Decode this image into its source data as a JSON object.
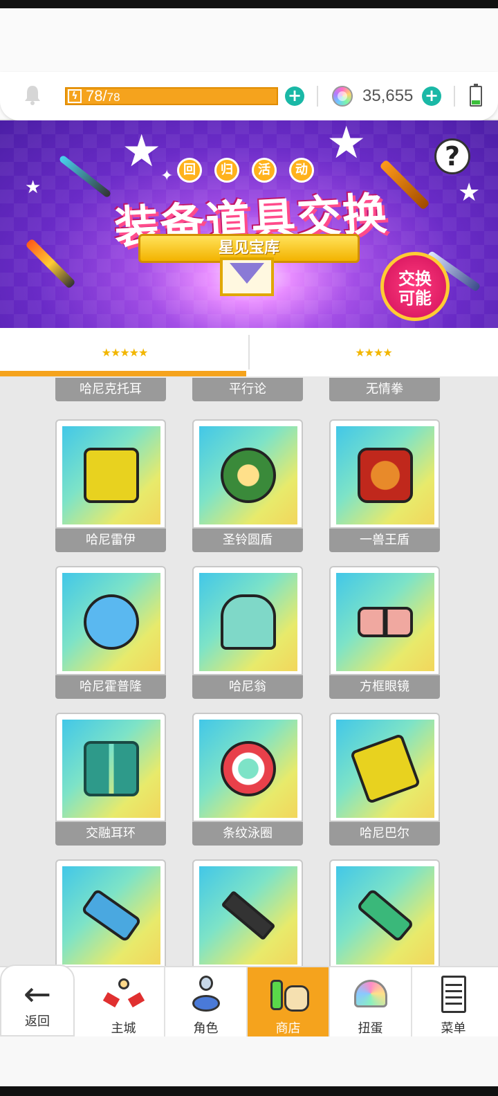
{
  "status": {
    "energy_current": "78",
    "energy_sep": "/",
    "energy_max": "78",
    "energy_fill_fraction": 1.0,
    "gems": "35,655"
  },
  "banner": {
    "tags": [
      "回",
      "归",
      "活",
      "动"
    ],
    "title": "装备道具交换",
    "ribbon": "星见宝库",
    "badge_line1": "交换",
    "badge_line2": "可能",
    "help": "?"
  },
  "tabs": [
    {
      "label": "★★★★★",
      "active": true
    },
    {
      "label": "★★★★",
      "active": false
    }
  ],
  "items_partial_row": [
    "哈尼克托耳",
    "平行论",
    "无情拳"
  ],
  "items": [
    {
      "name": "哈尼雷伊",
      "icon": "golden-gauntlet-icon",
      "color": "#e8d21f"
    },
    {
      "name": "圣铃圆盾",
      "icon": "wreath-shield-icon",
      "color": "#3a8a3a"
    },
    {
      "name": "一兽王盾",
      "icon": "lion-shield-icon",
      "color": "#d2541c"
    },
    {
      "name": "哈尼霍普隆",
      "icon": "blue-round-shield-icon",
      "color": "#5ab8f0"
    },
    {
      "name": "哈尼翁",
      "icon": "teal-spirit-icon",
      "color": "#7fd8c8"
    },
    {
      "name": "方框眼镜",
      "icon": "glasses-icon",
      "color": "#f0a8a0"
    },
    {
      "name": "交融耳环",
      "icon": "earrings-icon",
      "color": "#2e9a8a"
    },
    {
      "name": "条纹泳圈",
      "icon": "swim-ring-icon",
      "color": "#e8404a"
    },
    {
      "name": "哈尼巴尔",
      "icon": "golden-crown-icon",
      "color": "#e8d21f"
    },
    {
      "name": "",
      "icon": "blue-cannon-icon",
      "color": "#4aa8e0"
    },
    {
      "name": "",
      "icon": "assault-rifle-icon",
      "color": "#333333"
    },
    {
      "name": "",
      "icon": "green-blaster-icon",
      "color": "#3ab87a"
    }
  ],
  "nav": {
    "back": "返回",
    "items": [
      {
        "label": "主城",
        "icon": "castle-icon"
      },
      {
        "label": "角色",
        "icon": "character-icon"
      },
      {
        "label": "商店",
        "icon": "shop-icon",
        "active": true
      },
      {
        "label": "扭蛋",
        "icon": "gacha-icon"
      },
      {
        "label": "菜单",
        "icon": "menu-list-icon"
      }
    ]
  },
  "colors": {
    "accent": "#f5a31d",
    "plus": "#1ab8a6",
    "label_bg": "#9a9a9a"
  }
}
